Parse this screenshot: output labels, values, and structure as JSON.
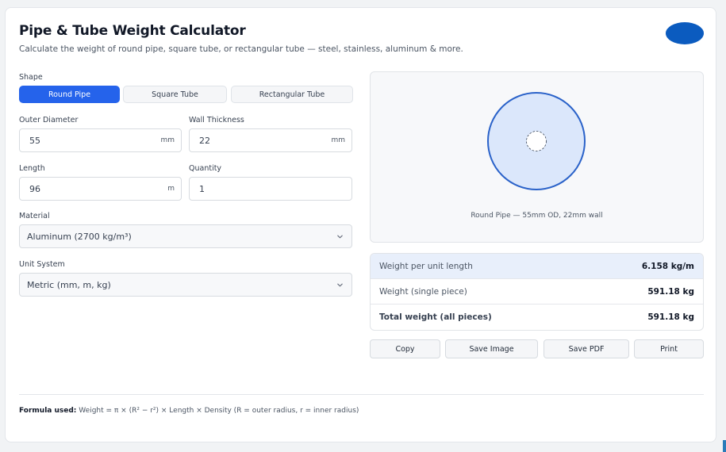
{
  "header": {
    "title": "Pipe & Tube Weight Calculator",
    "subtitle": "Calculate the weight of round pipe, square tube, or rectangular tube — steel, stainless, aluminum & more."
  },
  "colors": {
    "accent": "#2563eb",
    "brand": "#0b5bbf",
    "result_highlight": "#e8effb",
    "pipe_fill": "#dbe7fb",
    "pipe_stroke": "#2a62c9"
  },
  "shape": {
    "label": "Shape",
    "options": [
      "Round Pipe",
      "Square Tube",
      "Rectangular Tube"
    ],
    "selected": "Round Pipe"
  },
  "fields": {
    "outer_diameter": {
      "label": "Outer Diameter",
      "value": "55",
      "unit": "mm"
    },
    "wall_thickness": {
      "label": "Wall Thickness",
      "value": "22",
      "unit": "mm"
    },
    "length": {
      "label": "Length",
      "value": "96",
      "unit": "m"
    },
    "quantity": {
      "label": "Quantity",
      "value": "1"
    }
  },
  "material": {
    "label": "Material",
    "value": "Aluminum (2700 kg/m³)"
  },
  "unit_system": {
    "label": "Unit System",
    "value": "Metric (mm, m, kg)"
  },
  "preview": {
    "caption": "Round Pipe — 55mm OD, 22mm wall"
  },
  "results": {
    "per_length": {
      "label": "Weight per unit length",
      "value": "6.158 kg/m"
    },
    "single": {
      "label": "Weight (single piece)",
      "value": "591.18 kg"
    },
    "total": {
      "label": "Total weight (all pieces)",
      "value": "591.18 kg"
    }
  },
  "actions": {
    "copy": "Copy",
    "save_image": "Save Image",
    "save_pdf": "Save PDF",
    "print": "Print"
  },
  "formula": {
    "label": "Formula used:",
    "text": "Weight = π × (R² − r²) × Length × Density (R = outer radius, r = inner radius)"
  },
  "icons": {
    "select_chevron": "chevron-down-icon"
  }
}
